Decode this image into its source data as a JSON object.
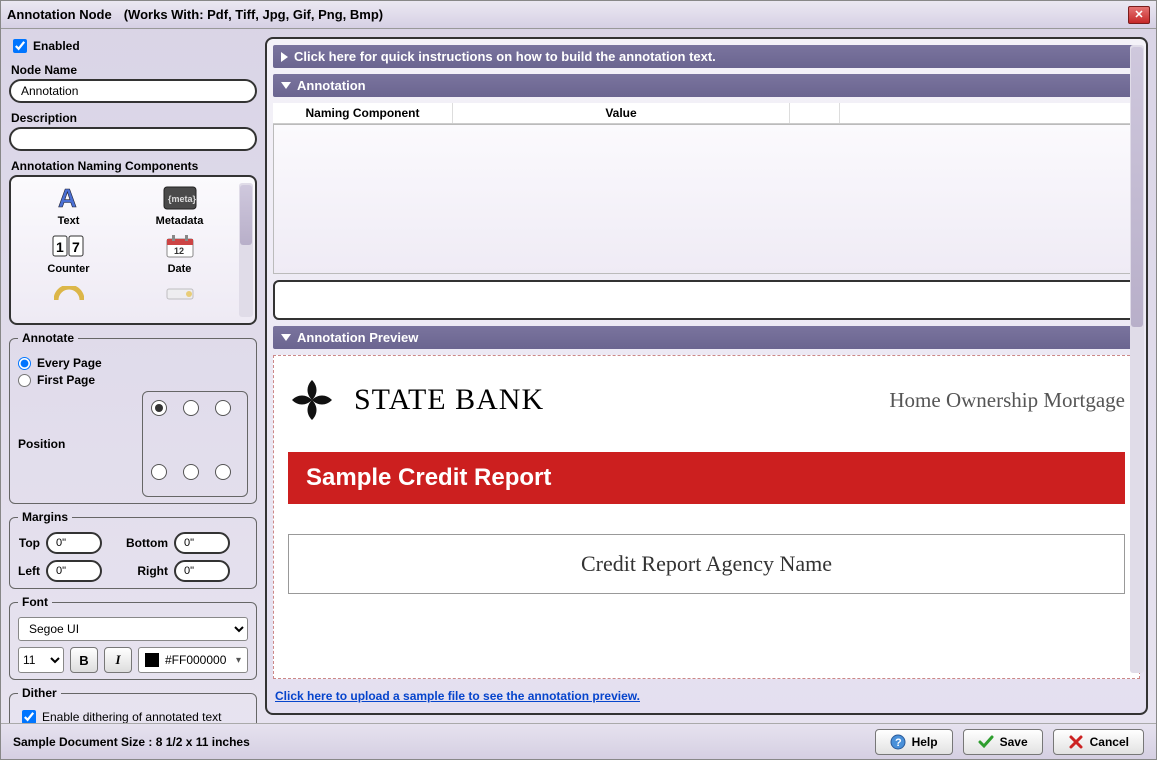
{
  "titlebar": {
    "title": "Annotation Node",
    "worksWith": "(Works With: Pdf, Tiff, Jpg, Gif, Png, Bmp)"
  },
  "left": {
    "enabled_label": "Enabled",
    "nodeName_label": "Node Name",
    "nodeName_value": "Annotation",
    "description_label": "Description",
    "description_value": "",
    "components_label": "Annotation Naming Components",
    "components": {
      "text": "Text",
      "metadata": "Metadata",
      "counter": "Counter",
      "date": "Date"
    },
    "annotate": {
      "legend": "Annotate",
      "every": "Every Page",
      "first": "First Page",
      "position_label": "Position"
    },
    "margins": {
      "legend": "Margins",
      "top_label": "Top",
      "top_value": "0\"",
      "bottom_label": "Bottom",
      "bottom_value": "0\"",
      "left_label": "Left",
      "left_value": "0\"",
      "right_label": "Right",
      "right_value": "0\""
    },
    "font": {
      "legend": "Font",
      "family": "Segoe UI",
      "size": "11",
      "color": "#FF000000"
    },
    "dither": {
      "legend": "Dither",
      "label": "Enable dithering of annotated text"
    }
  },
  "right": {
    "instructions": "Click here for quick instructions on how to build the annotation text.",
    "annotation_hdr": "Annotation",
    "table": {
      "col1": "Naming Component",
      "col2": "Value"
    },
    "preview_hdr": "Annotation Preview",
    "preview": {
      "bank": "STATE BANK",
      "mortgage": "Home Ownership Mortgage",
      "redbar": "Sample Credit Report",
      "agency": "Credit Report Agency Name"
    },
    "upload_link": "Click here to upload a sample file to see the annotation preview."
  },
  "footer": {
    "docsize": "Sample Document Size : 8 1/2 x 11 inches",
    "help": "Help",
    "save": "Save",
    "cancel": "Cancel"
  }
}
